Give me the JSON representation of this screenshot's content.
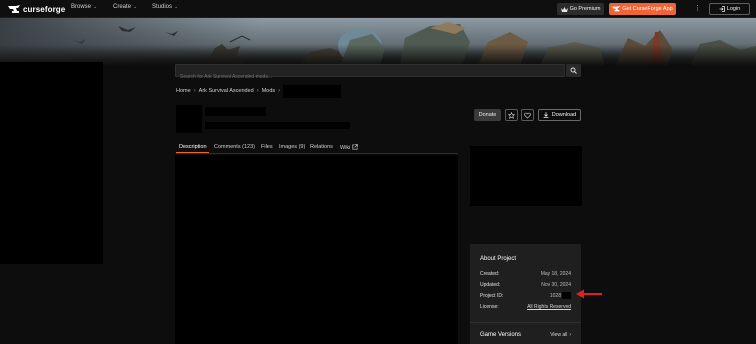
{
  "brand": {
    "name": "curseforge",
    "accent": "#f16436"
  },
  "nav": {
    "items": [
      {
        "label": "Browse"
      },
      {
        "label": "Create"
      },
      {
        "label": "Studios"
      }
    ],
    "premium_label": "Go Premium",
    "app_label": "Get CurseForge App",
    "login_label": "Login"
  },
  "search": {
    "placeholder": "Search for Ark Survival Ascended mods..."
  },
  "breadcrumb": {
    "home": "Home",
    "game": "Ark Survival Ascended",
    "section": "Mods"
  },
  "actions": {
    "donate_label": "Donate",
    "download_label": "Download"
  },
  "tabs": [
    {
      "label": "Description"
    },
    {
      "label": "Comments (123)"
    },
    {
      "label": "Files"
    },
    {
      "label": "Images (9)"
    },
    {
      "label": "Relations"
    },
    {
      "label": "Wiki"
    }
  ],
  "about": {
    "title": "About Project",
    "created_label": "Created:",
    "created_value": "May 18, 2024",
    "updated_label": "Updated:",
    "updated_value": "Nov 30, 2024",
    "project_id_label": "Project ID:",
    "project_id_value": "1028",
    "license_label": "License:",
    "license_value": "All Rights Reserved"
  },
  "game_versions": {
    "title": "Game Versions",
    "view_all_label": "View all"
  },
  "icons": [
    "curseforge-logo-icon",
    "chevron-down-icon",
    "crown-icon",
    "kebab-menu-icon",
    "login-icon",
    "search-icon",
    "star-icon",
    "heart-icon",
    "download-icon",
    "external-link-icon",
    "chevron-right-icon",
    "red-arrow-icon"
  ],
  "annotation": {
    "arrow_color": "#e02020"
  }
}
